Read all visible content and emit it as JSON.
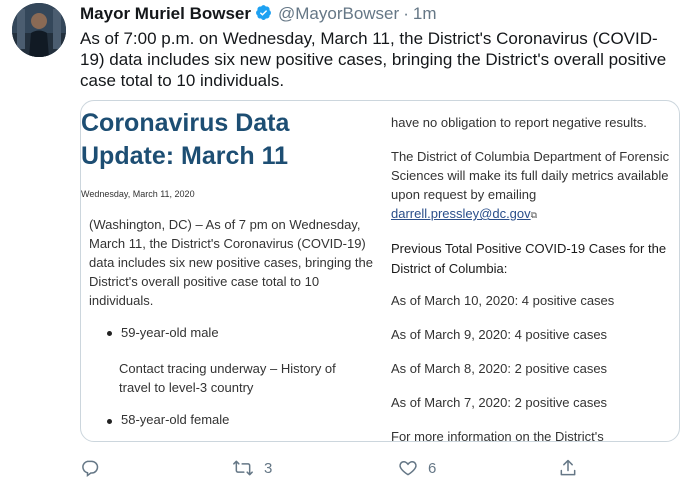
{
  "tweet": {
    "display_name": "Mayor Muriel Bowser",
    "handle": "@MayorBowser",
    "separator": "·",
    "time": "1m",
    "text": "As of 7:00 p.m. on Wednesday, March 11, the District's Coronavirus (COVID-19) data includes six new positive cases, bringing the District's overall positive case total to 10 individuals."
  },
  "card": {
    "title_line1": "Coronavirus Data",
    "title_line2": "Update: March 11",
    "date": "Wednesday, March 11, 2020",
    "paragraph": "(Washington, DC) – As of 7 pm on Wednesday, March 11, the District's Coronavirus (COVID-19) data includes six new positive cases, bringing the District's overall positive case total to 10 individuals.",
    "bullet1": "59-year-old male",
    "note1": "Contact tracing underway – History of travel to level-3 country",
    "bullet2": "58-year-old female",
    "right_top": "have no obligation to report negative results.",
    "right_para": "The District of Columbia Department of Forensic Sciences will make its full daily metrics available upon request by emailing",
    "email": "darrell.pressley@dc.gov",
    "prev_heading": "Previous Total Positive COVID-19 Cases for the District of Columbia:",
    "prev_cases": [
      "As of March 10, 2020: 4 positive cases",
      "As of March 9, 2020: 4 positive cases",
      "As of March 8, 2020: 2 positive cases",
      "As of March 7, 2020: 2 positive cases"
    ],
    "more_info": "For more information on the District's"
  },
  "actions": {
    "reply_icon": "reply-icon",
    "retweet_icon": "retweet-icon",
    "retweet_count": "3",
    "like_icon": "heart-icon",
    "like_count": "6",
    "share_icon": "share-icon"
  },
  "colors": {
    "title_blue": "#1d4e73",
    "verified_blue": "#1da1f2",
    "muted": "#657786"
  }
}
